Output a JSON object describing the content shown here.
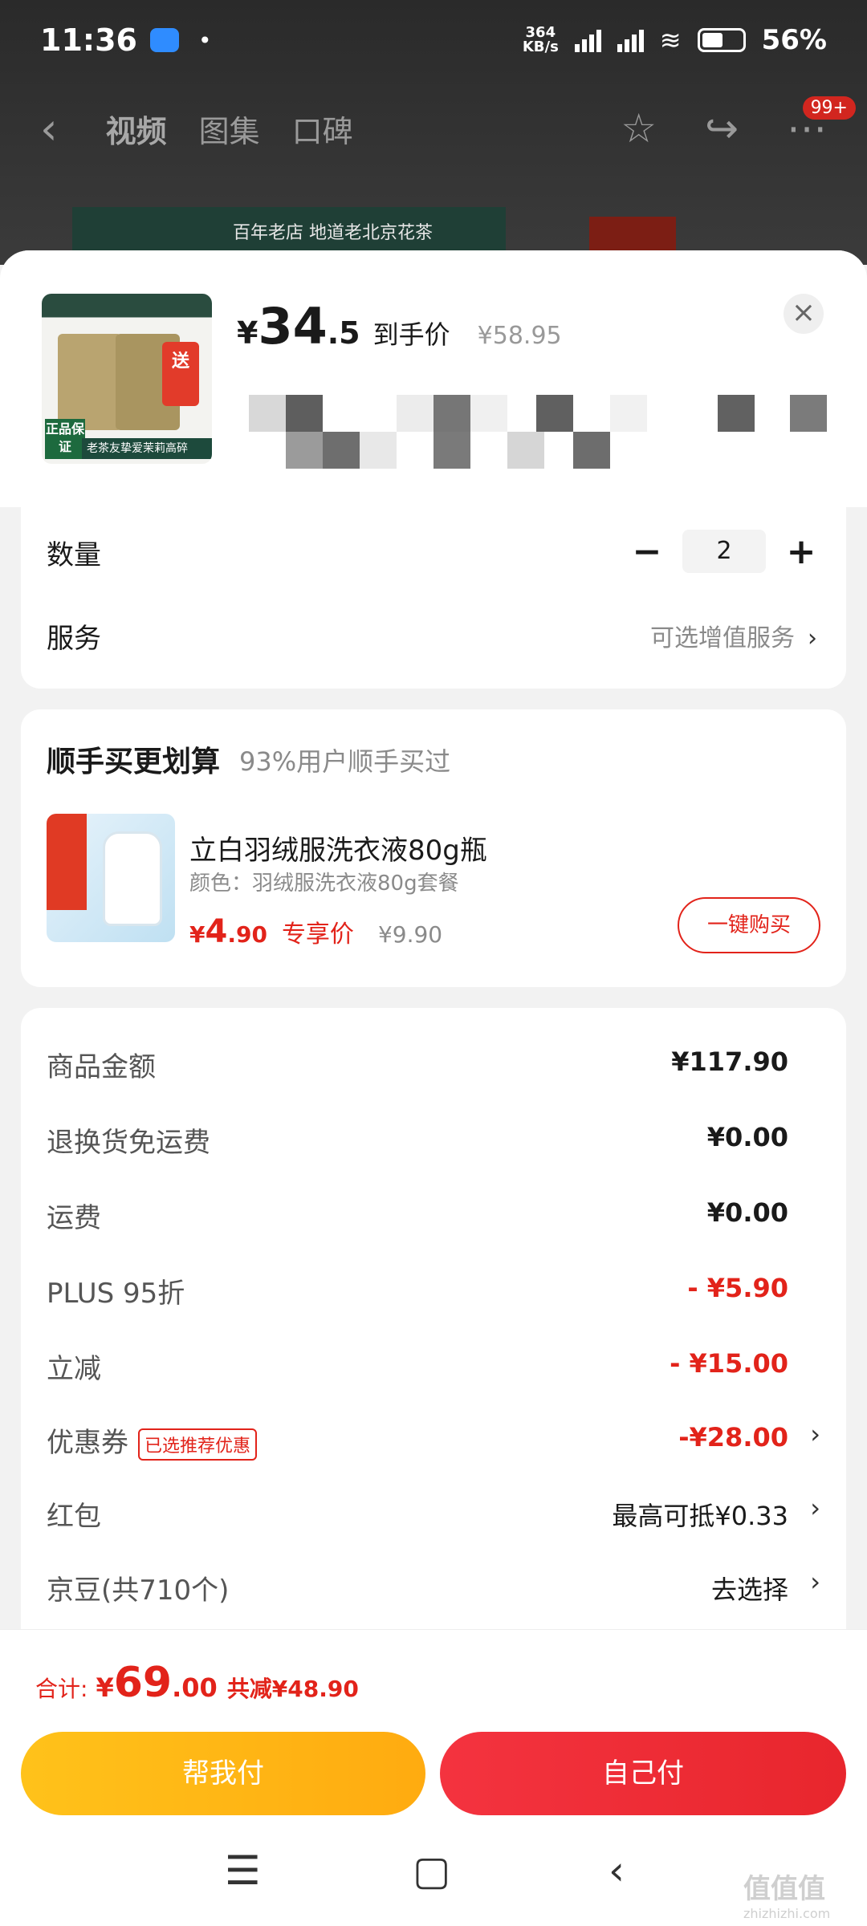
{
  "status_bar": {
    "time": "11:36",
    "dot": "•",
    "speed_value": "364",
    "speed_unit": "KB/s",
    "battery": "56%"
  },
  "top_nav": {
    "back_icon": "‹",
    "tabs": [
      "视频",
      "图集",
      "口碑"
    ],
    "badge": "99+",
    "banner_text": "百年老店 地道老北京花茶"
  },
  "product": {
    "currency": "¥",
    "price_int": "34",
    "price_dec": ".5",
    "price_label": "到手价",
    "original_price": "¥58.95",
    "close_icon": "×",
    "thumb_badge": "正品保证",
    "thumb_strip": "老茶友挚爱茉莉高碎",
    "thumb_gift": "送"
  },
  "quantity": {
    "label": "数量",
    "minus": "−",
    "value": "2",
    "plus": "+"
  },
  "service": {
    "label": "服务",
    "value": "可选增值服务"
  },
  "addon": {
    "title": "顺手买更划算",
    "subtitle": "93%用户顺手买过",
    "name": "立白羽绒服洗衣液80g瓶",
    "spec": "颜色：羽绒服洗衣液80g套餐",
    "currency": "¥",
    "price_int": "4",
    "price_dec": ".90",
    "price_label": "专享价",
    "original_price": "¥9.90",
    "buy_button": "一键购买"
  },
  "fees": [
    {
      "label": "商品金额",
      "value": "¥117.90"
    },
    {
      "label": "退换货免运费",
      "value": "¥0.00"
    },
    {
      "label": "运费",
      "value": "¥0.00"
    },
    {
      "label": "PLUS 95折",
      "value": "- ¥5.90"
    },
    {
      "label": "立减",
      "value": "- ¥15.00"
    },
    {
      "label": "优惠券",
      "tag": "已选推荐优惠",
      "value": "-¥28.00"
    },
    {
      "label": "红包",
      "value": "最高可抵¥0.33"
    },
    {
      "label": "京豆(共710个)",
      "value": "去选择"
    }
  ],
  "chevron": "›",
  "total": {
    "label": "合计:",
    "currency": "¥",
    "int": "69",
    "dec": ".00",
    "savings": "共减¥48.90"
  },
  "pay_buttons": {
    "friend": "帮我付",
    "self": "自己付"
  },
  "nav_keys": {
    "menu": "☰",
    "home": "▢",
    "back": "‹"
  },
  "watermark": {
    "main": "值值值",
    "sub": "zhizhizhi.com"
  },
  "colors": {
    "accent_red": "#e2231a",
    "pay_yellow": "#ffb814",
    "pay_red": "#f02a35"
  }
}
